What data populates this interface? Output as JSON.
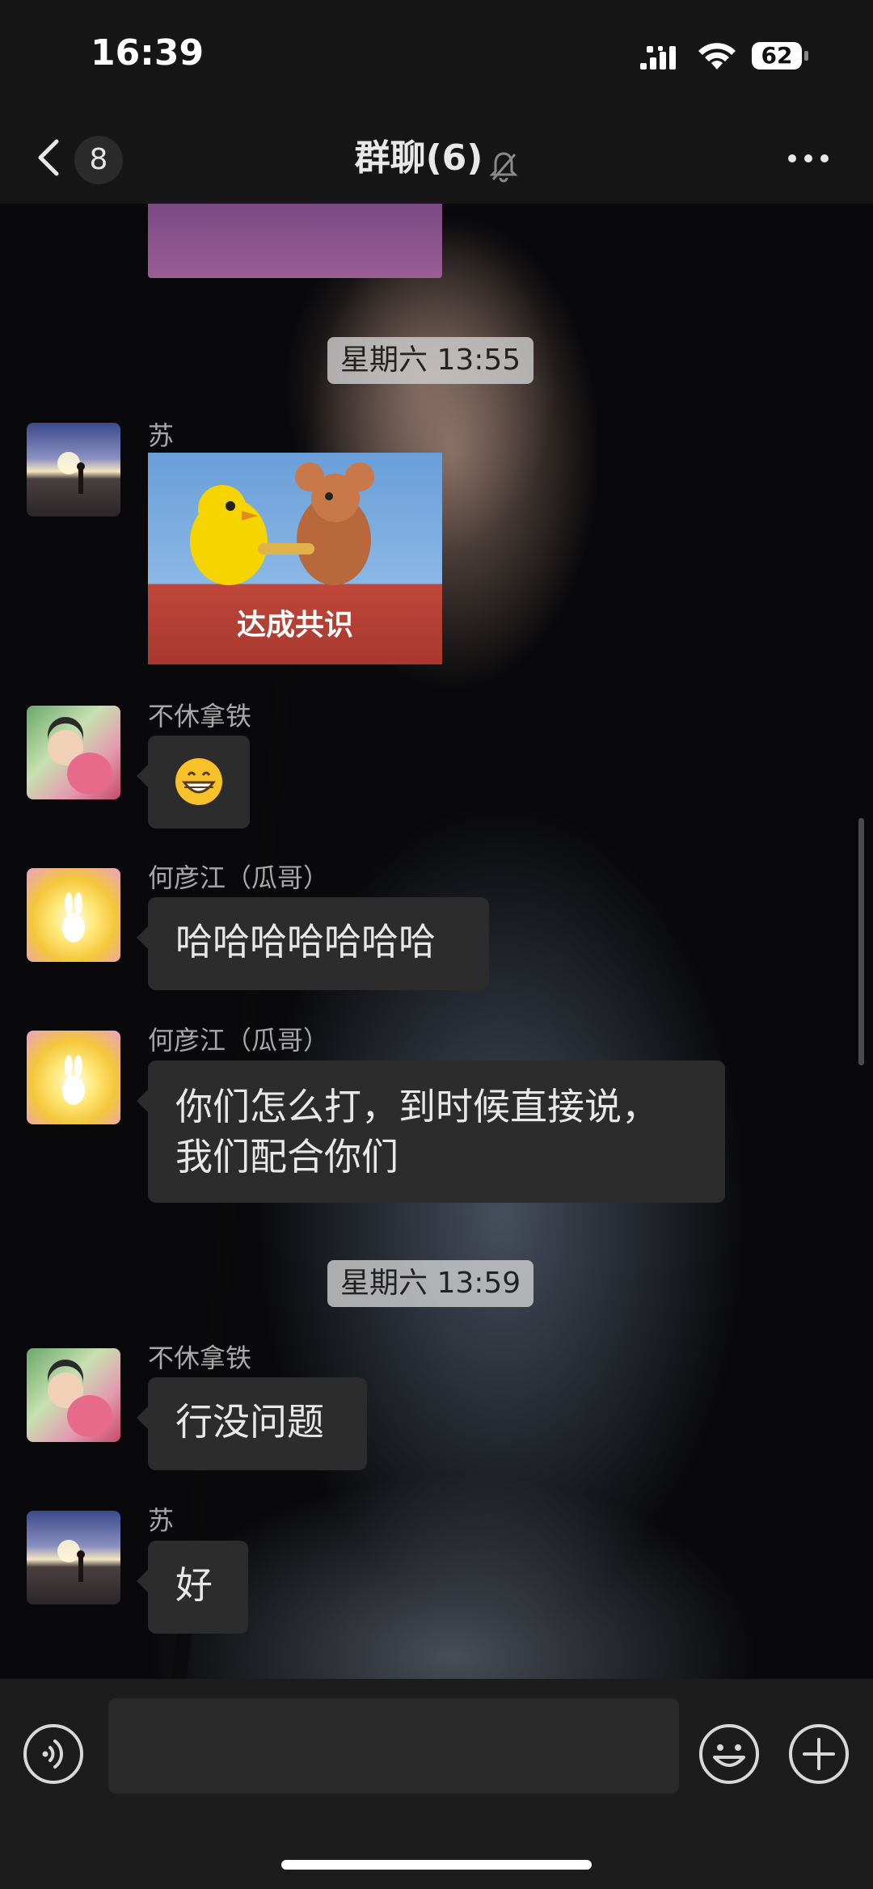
{
  "status_bar": {
    "time": "16:39",
    "battery": "62"
  },
  "nav": {
    "back_badge": "8",
    "title": "群聊(6)"
  },
  "messages": {
    "sep1": "星期六 13:55",
    "msg1": {
      "sender": "苏",
      "sticker_text": "达成共识"
    },
    "msg2": {
      "sender": "不休拿铁",
      "emoji": "grinning-face"
    },
    "msg3": {
      "sender": "何彦江（瓜哥）",
      "line1": "哈哈哈哈哈哈哈"
    },
    "msg4": {
      "sender": "何彦江（瓜哥）",
      "line1": "你们怎么打，到时候直接说，",
      "line2": "我们配合你们"
    },
    "sep2": "星期六 13:59",
    "msg5": {
      "sender": "不休拿铁",
      "line1": "行没问题"
    },
    "msg6": {
      "sender": "苏",
      "line1": "好"
    }
  },
  "colors": {
    "bubble": "#2c2c2c",
    "bar": "#161616",
    "input_bar": "#1c1c1c",
    "sender_text": "#a8a8a8"
  }
}
